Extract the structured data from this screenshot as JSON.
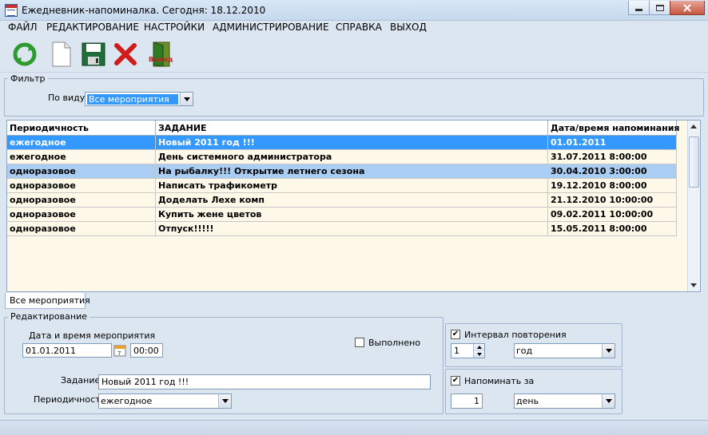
{
  "window": {
    "title": "Ежедневник-напоминалка. Сегодня: 18.12.2010"
  },
  "menu": [
    {
      "label": "ФАЙЛ"
    },
    {
      "label": "РЕДАКТИРОВАНИЕ"
    },
    {
      "label": "НАСТРОЙКИ"
    },
    {
      "label": "АДМИНИСТРИРОВАНИЕ"
    },
    {
      "label": "СПРАВКА"
    },
    {
      "label": "ВЫХОД"
    }
  ],
  "toolbar": {
    "buttons": [
      "refresh-icon",
      "new-document-icon",
      "save-icon",
      "delete-icon",
      "exit-door-icon"
    ],
    "exit_icon_text": "Выход"
  },
  "filter": {
    "legend": "Фильтр",
    "by_type_label": "По виду",
    "by_type_value": "Все мероприятия"
  },
  "table": {
    "columns": [
      "Периодичность",
      "ЗАДАНИЕ",
      "Дата/время напоминания"
    ],
    "rows": [
      {
        "period": "ежегодное",
        "task": "Новый 2011 год !!!",
        "datetime": "01.01.2011"
      },
      {
        "period": "ежегодное",
        "task": "День системного администратора",
        "datetime": "31.07.2011 8:00:00"
      },
      {
        "period": "одноразовое",
        "task": "На рыбалку!!! Открытие летнего сезона",
        "datetime": "30.04.2010 3:00:00"
      },
      {
        "period": "одноразовое",
        "task": "Написать трафикометр",
        "datetime": "19.12.2010 8:00:00"
      },
      {
        "period": "одноразовое",
        "task": "Доделать Лехе комп",
        "datetime": "21.12.2010 10:00:00"
      },
      {
        "period": "одноразовое",
        "task": "Купить жене цветов",
        "datetime": "09.02.2011 10:00:00"
      },
      {
        "period": "одноразовое",
        "task": "Отпуск!!!!!",
        "datetime": "15.05.2011 8:00:00"
      }
    ]
  },
  "tab": {
    "label": "Все мероприятия"
  },
  "edit": {
    "legend": "Редактирование",
    "datetime_label": "Дата и время мероприятия",
    "date_value": "01.01.2011",
    "time_value": "00:00",
    "done_label": "Выполнено",
    "done_checked": false,
    "task_label": "Задание",
    "task_value": "Новый 2011 год !!!",
    "period_label": "Периодичность",
    "period_value": "ежегодное"
  },
  "repeat": {
    "label": "Интервал повторения",
    "checked": true,
    "count": "1",
    "unit": "год"
  },
  "remind": {
    "label": "Напоминать за",
    "checked": true,
    "count": "1",
    "unit": "день"
  },
  "colors": {
    "selection": "#3399ff",
    "secondary_selection": "#a9cdf3",
    "grid_background": "#fdf8e8",
    "window_background": "#dbe6f1"
  }
}
